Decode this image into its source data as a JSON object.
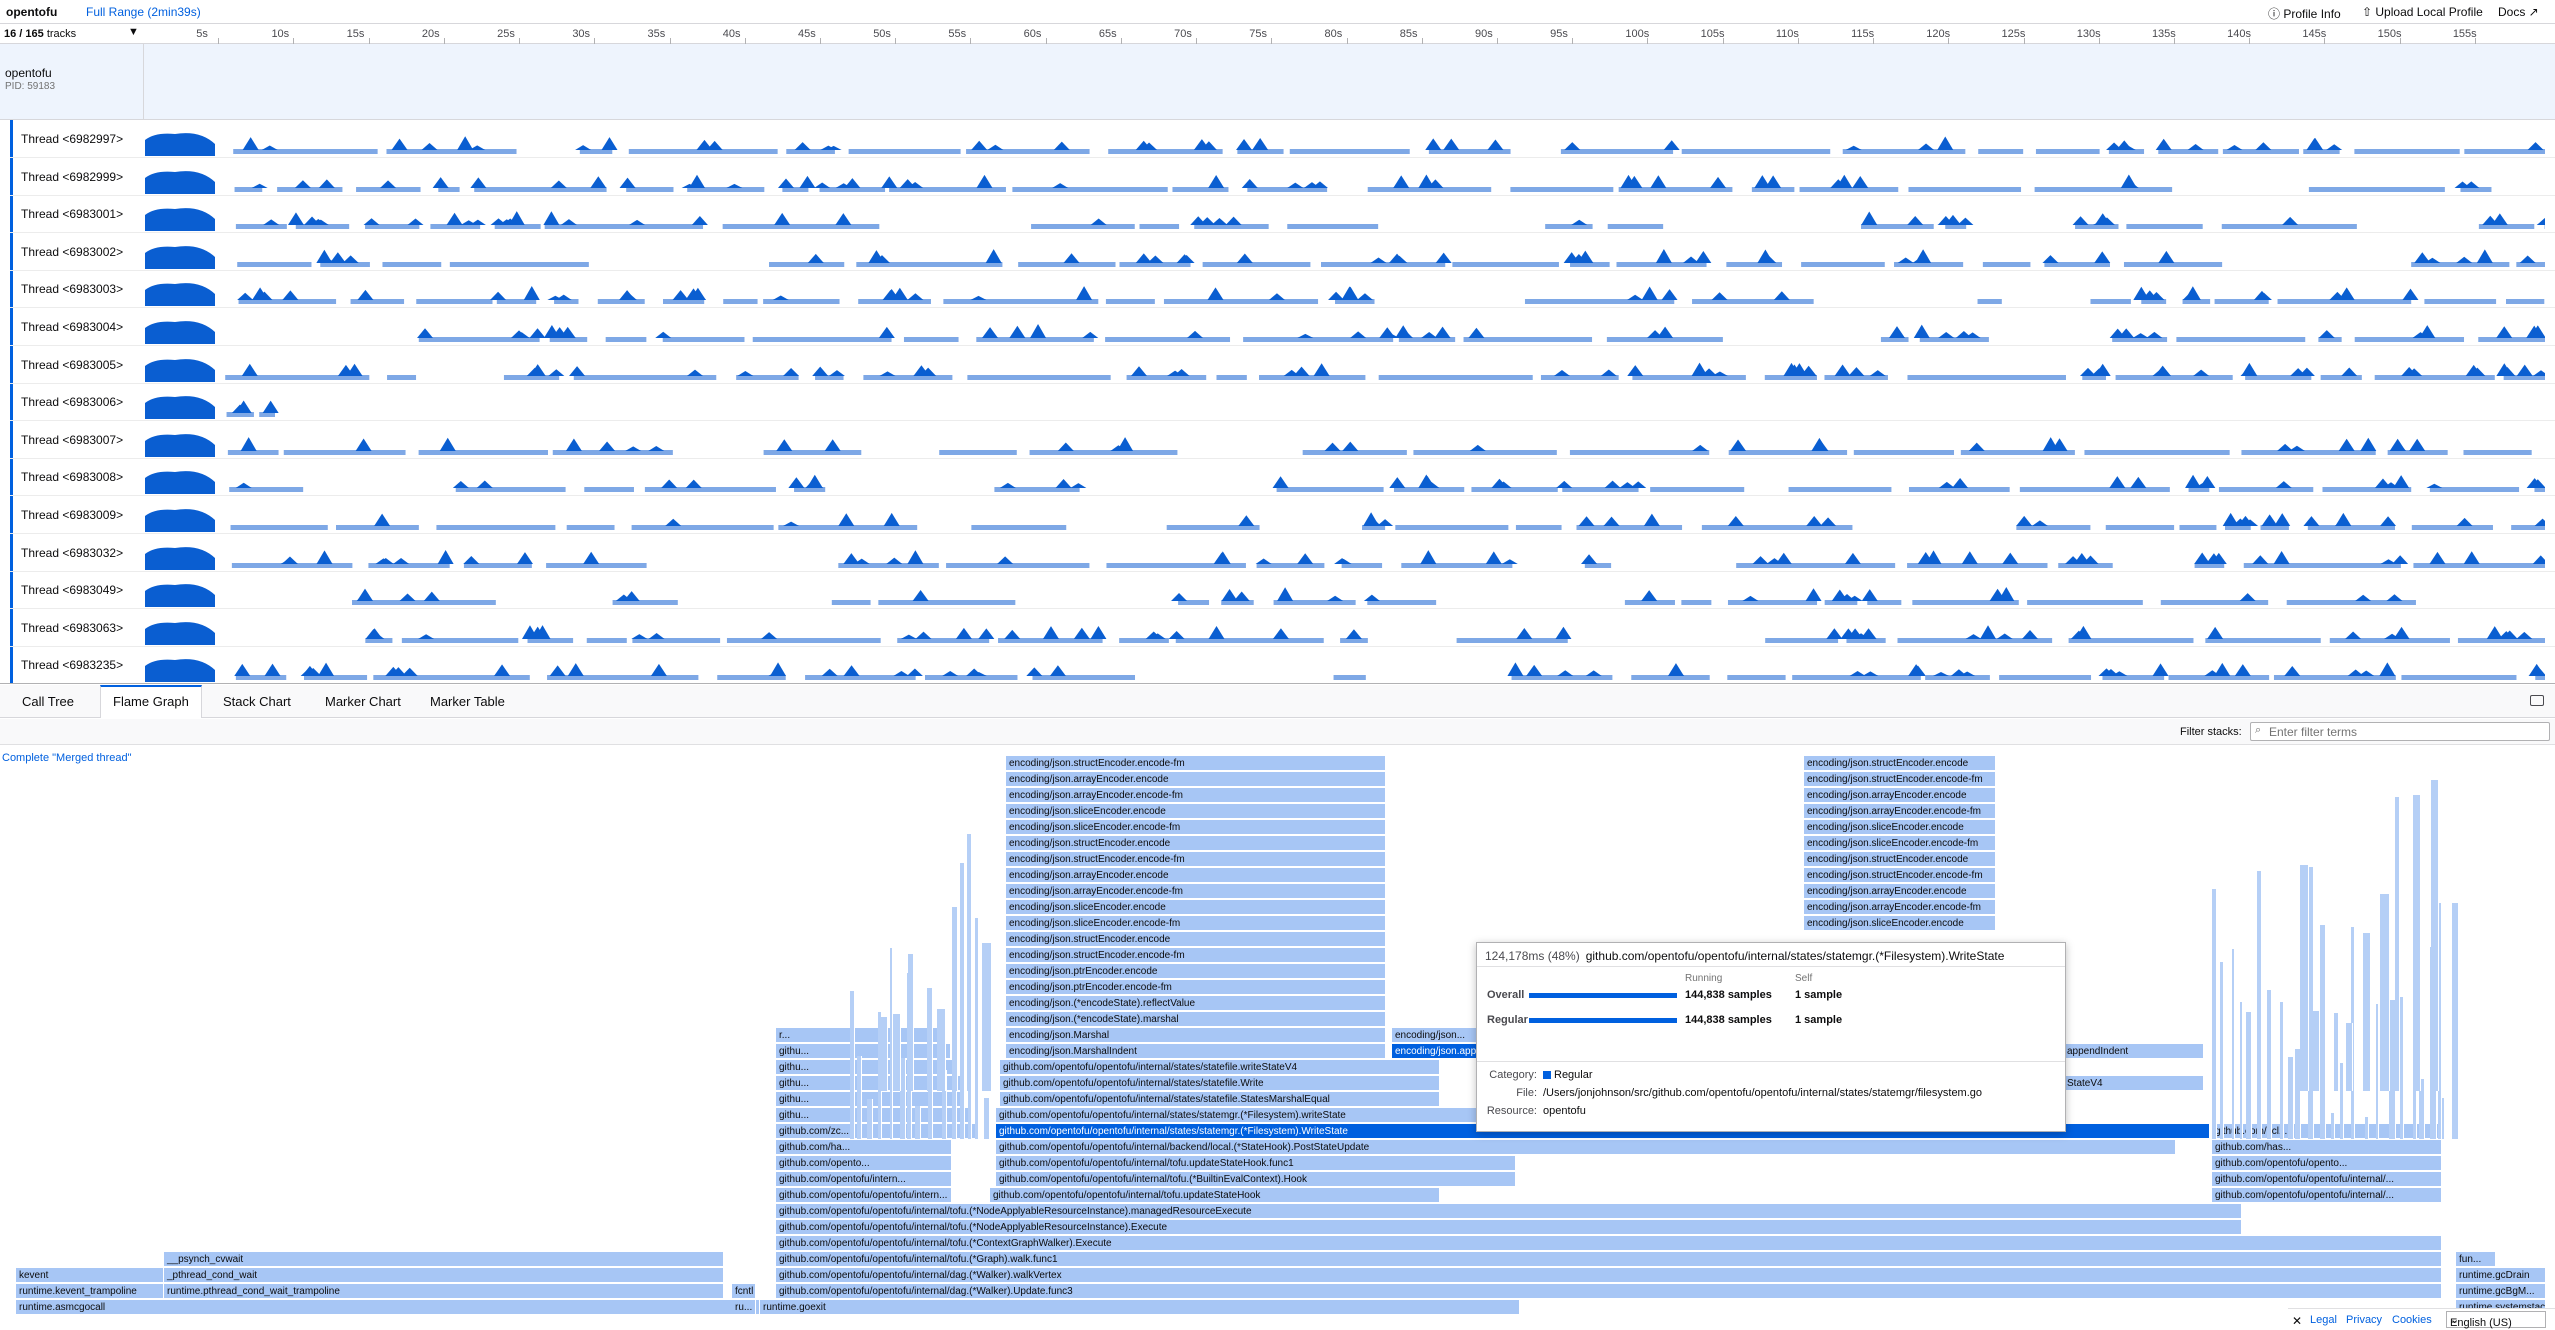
{
  "app": {
    "name": "opentofu",
    "range": "Full Range (2min39s)"
  },
  "topbar": {
    "profile_info": "Profile Info",
    "upload": "Upload Local Profile",
    "docs": "Docs"
  },
  "timeline": {
    "track_count": "16 / 165",
    "track_suffix": "tracks",
    "ticks": [
      "5s",
      "10s",
      "15s",
      "20s",
      "25s",
      "30s",
      "35s",
      "40s",
      "45s",
      "50s",
      "55s",
      "60s",
      "65s",
      "70s",
      "75s",
      "80s",
      "85s",
      "90s",
      "95s",
      "100s",
      "105s",
      "110s",
      "115s",
      "120s",
      "125s",
      "130s",
      "135s",
      "140s",
      "145s",
      "150s",
      "155s"
    ],
    "process": {
      "name": "opentofu",
      "pid": "PID: 59183"
    },
    "threads": [
      "Thread <6982997>",
      "Thread <6982999>",
      "Thread <6983001>",
      "Thread <6983002>",
      "Thread <6983003>",
      "Thread <6983004>",
      "Thread <6983005>",
      "Thread <6983006>",
      "Thread <6983007>",
      "Thread <6983008>",
      "Thread <6983009>",
      "Thread <6983032>",
      "Thread <6983049>",
      "Thread <6983063>",
      "Thread <6983235>"
    ]
  },
  "tabs": [
    "Call Tree",
    "Flame Graph",
    "Stack Chart",
    "Marker Chart",
    "Marker Table"
  ],
  "selected_tab": "Flame Graph",
  "filter": {
    "label": "Filter stacks:",
    "placeholder": "Enter filter terms"
  },
  "flame": {
    "status": "Complete \"Merged thread\"",
    "center_stack": [
      "encoding/json.structEncoder.encode-fm",
      "encoding/json.arrayEncoder.encode",
      "encoding/json.arrayEncoder.encode-fm",
      "encoding/json.sliceEncoder.encode",
      "encoding/json.sliceEncoder.encode-fm",
      "encoding/json.structEncoder.encode",
      "encoding/json.structEncoder.encode-fm",
      "encoding/json.arrayEncoder.encode",
      "encoding/json.arrayEncoder.encode-fm",
      "encoding/json.sliceEncoder.encode",
      "encoding/json.sliceEncoder.encode-fm",
      "encoding/json.structEncoder.encode",
      "encoding/json.structEncoder.encode-fm",
      "encoding/json.ptrEncoder.encode",
      "encoding/json.ptrEncoder.encode-fm",
      "encoding/json.(*encodeState).reflectValue",
      "encoding/json.(*encodeState).marshal",
      "encoding/json.Marshal",
      "encoding/json.MarshalIndent"
    ],
    "right_stack": [
      "encoding/json.structEncoder.encode",
      "encoding/json.structEncoder.encode-fm",
      "encoding/json.arrayEncoder.encode",
      "encoding/json.arrayEncoder.encode-fm",
      "encoding/json.sliceEncoder.encode",
      "encoding/json.sliceEncoder.encode-fm",
      "encoding/json.structEncoder.encode",
      "encoding/json.structEncoder.encode-fm",
      "encoding/json.arrayEncoder.encode",
      "encoding/json.arrayEncoder.encode-fm",
      "encoding/json.sliceEncoder.encode"
    ],
    "small": {
      "marshal1": "encoding/json...",
      "marshal2": "encoding/json.app",
      "indent": "appendIndent",
      "wsv4": "StateV4"
    },
    "wide_rows": [
      "github.com/opentofu/opentofu/internal/states/statefile.writeStateV4",
      "github.com/opentofu/opentofu/internal/states/statefile.Write",
      "github.com/opentofu/opentofu/internal/states/statefile.StatesMarshalEqual",
      "github.com/opentofu/opentofu/internal/states/statemgr.(*Filesystem).writeState",
      "github.com/opentofu/opentofu/internal/states/statemgr.(*Filesystem).WriteState",
      "github.com/opentofu/opentofu/internal/backend/local.(*StateHook).PostStateUpdate",
      "github.com/opentofu/opentofu/internal/tofu.updateStateHook.func1",
      "github.com/opentofu/opentofu/internal/tofu.(*BuiltinEvalContext).Hook",
      "github.com/opentofu/opentofu/internal/tofu.updateStateHook",
      "github.com/opentofu/opentofu/internal/tofu.(*NodeApplyableResourceInstance).managedResourceExecute",
      "github.com/opentofu/opentofu/internal/tofu.(*NodeApplyableResourceInstance).Execute",
      "github.com/opentofu/opentofu/internal/tofu.(*ContextGraphWalker).Execute",
      "github.com/opentofu/opentofu/internal/tofu.(*Graph).walk.func1",
      "github.com/opentofu/opentofu/internal/dag.(*Walker).walkVertex",
      "github.com/opentofu/opentofu/internal/dag.(*Walker).Update.func3"
    ],
    "left_col": [
      "r...",
      "githu...",
      "githu...",
      "githu...",
      "githu...",
      "githu...",
      "github.com/zc...",
      "github.com/ha...",
      "github.com/opento...",
      "github.com/opentofu/intern...",
      "github.com/opentofu/opentofu/intern..."
    ],
    "right_col": [
      "github.com/opentofu/opentofu/internal/...",
      "github.com/opentofu/opentofu/internal/...",
      "github.com/opentofu/opento...",
      "github.com/has...",
      "github.com/zcl..."
    ],
    "bottom": {
      "kevent": "kevent",
      "trampoline": "runtime.kevent_trampoline",
      "asmcgocall": "runtime.asmcgocall",
      "psynch": "__psynch_cvwait",
      "cond": "_pthread_cond_wait",
      "condtramp": "runtime.pthread_cond_wait_trampoline",
      "goexit": "runtime.goexit",
      "fcntl": "fcntl",
      "ru": "ru...",
      "gcDrain": "runtime.gcDrain",
      "gcBgM": "runtime.gcBgM...",
      "sysmon": "runtime.systemstack",
      "fun": "fun..."
    }
  },
  "tooltip": {
    "time": "124,178ms (48%)",
    "fn": "github.com/opentofu/opentofu/internal/states/statemgr.(*Filesystem).WriteState",
    "col_running": "Running",
    "col_self": "Self",
    "overall_label": "Overall",
    "regular_label": "Regular",
    "overall_samples": "144,838 samples",
    "overall_self": "1 sample",
    "regular_samples": "144,838 samples",
    "regular_self": "1 sample",
    "category_key": "Category:",
    "category_val": "Regular",
    "file_key": "File:",
    "file_val": "/Users/jonjohnson/src/github.com/opentofu/opentofu/internal/states/statemgr/filesystem.go",
    "resource_key": "Resource:",
    "resource_val": "opentofu"
  },
  "footer": {
    "legal": "Legal",
    "privacy": "Privacy",
    "cookies": "Cookies",
    "lang": "English (US)"
  },
  "colors": {
    "accent": "#0060df",
    "flame": "#a7c6f5",
    "graph": "#0a5ed1"
  }
}
